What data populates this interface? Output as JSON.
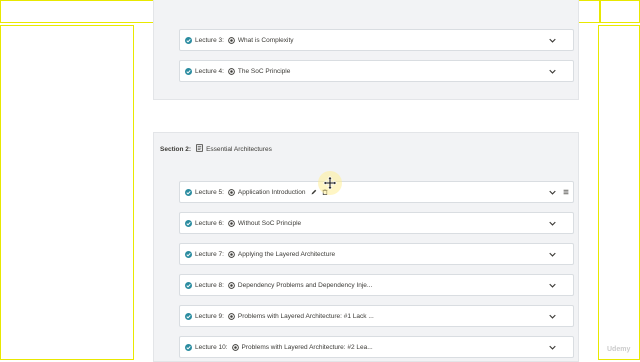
{
  "colors": {
    "accent": "#2b8ca0",
    "annotation_border": "#e8e800",
    "section_panel": "#f2f3f5"
  },
  "sections": [
    {
      "rows": [
        {
          "label": "Lecture 3:",
          "title": "What is Complexity",
          "icon": "play-circle-icon",
          "completed": true
        },
        {
          "label": "Lecture 4:",
          "title": "The SoC Principle",
          "icon": "play-circle-icon",
          "completed": true
        }
      ]
    },
    {
      "label": "Section 2:",
      "title": "Essential Architectures",
      "icon": "document-icon",
      "rows": [
        {
          "label": "Lecture 5:",
          "title": "Application Introduction",
          "icon": "play-circle-icon",
          "completed": true,
          "show_actions": true
        },
        {
          "label": "Lecture 6:",
          "title": "Without SoC Principle",
          "icon": "play-circle-icon",
          "completed": true
        },
        {
          "label": "Lecture 7:",
          "title": "Applying the Layered Architecture",
          "icon": "play-circle-icon",
          "completed": true
        },
        {
          "label": "Lecture 8:",
          "title": "Dependency Problems and Dependency Inje...",
          "icon": "play-circle-icon",
          "completed": true
        },
        {
          "label": "Lecture 9:",
          "title": "Problems with Layered Architecture: #1 Lack ...",
          "icon": "play-circle-icon",
          "completed": true
        },
        {
          "label": "Lecture 10:",
          "title": "Problems with Layered Architecture: #2 Lea...",
          "icon": "play-circle-icon",
          "completed": true
        }
      ]
    }
  ],
  "cursor": "move-cursor-icon",
  "watermark": "Udemy"
}
